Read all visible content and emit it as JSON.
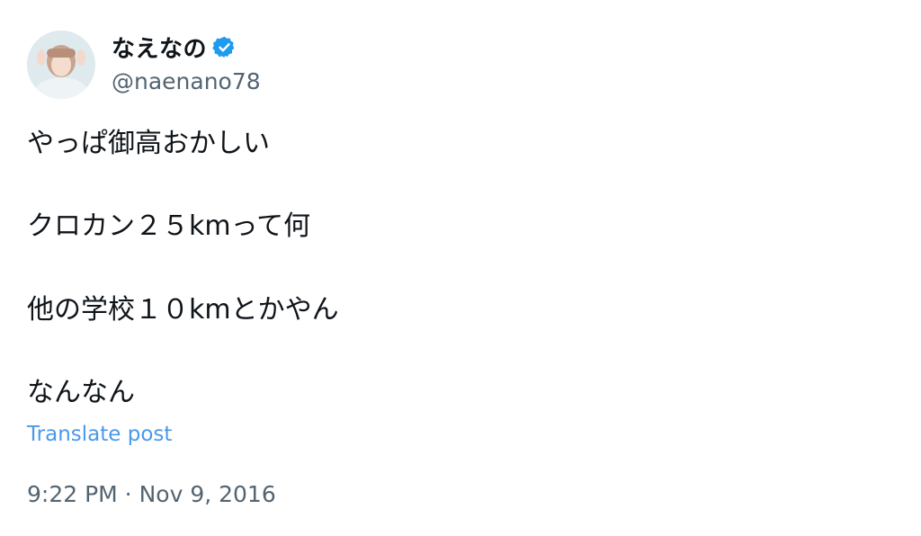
{
  "author": {
    "display_name": "なえなの",
    "handle": "@naenano78",
    "verified_icon": "verified-badge-icon",
    "avatar_icon": "profile-avatar"
  },
  "tweet": {
    "lines": [
      "やっぱ御高おかしい",
      "クロカン２５kmって何",
      "他の学校１０kmとかやん",
      "なんなん"
    ],
    "translate_label": "Translate post",
    "time": "9:22 PM",
    "separator": " · ",
    "date": "Nov 9, 2016"
  },
  "colors": {
    "text": "#0f1419",
    "secondary": "#536471",
    "link": "#4a99e9",
    "verified": "#1d9bf0"
  }
}
